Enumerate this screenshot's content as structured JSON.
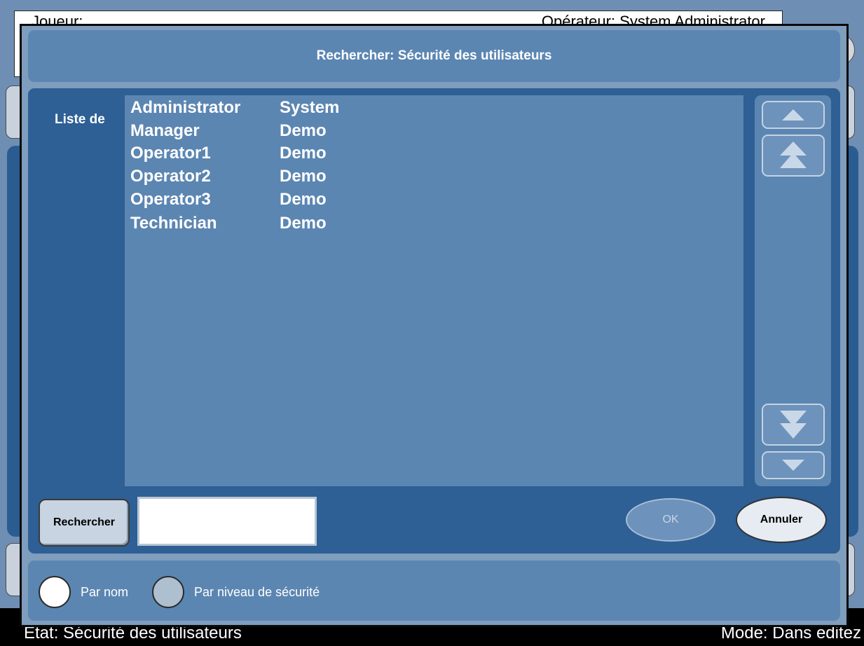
{
  "background": {
    "top_left_text": "Joueur:",
    "top_right_text": "Opérateur: System Administrator",
    "status_left": "État: Sécurité des utilisateurs",
    "status_right": "Mode: Dans editez"
  },
  "dialog": {
    "title": "Rechercher: Sécurité des utilisateurs",
    "list_label": "Liste de",
    "rows": [
      {
        "name": "Administrator",
        "group": "System"
      },
      {
        "name": "Manager",
        "group": "Demo"
      },
      {
        "name": "Operator1",
        "group": "Demo"
      },
      {
        "name": "Operator2",
        "group": "Demo"
      },
      {
        "name": "Operator3",
        "group": "Demo"
      },
      {
        "name": "Technician",
        "group": "Demo"
      }
    ],
    "scroll_icons": [
      "arrow-up-icon",
      "double-arrow-up-icon",
      "double-arrow-down-icon",
      "arrow-down-icon"
    ],
    "search_button": "Rechercher",
    "search_value": "",
    "ok_button": "OK",
    "cancel_button": "Annuler",
    "sort_options": [
      {
        "label": "Par nom",
        "selected": true
      },
      {
        "label": "Par niveau de sécurité",
        "selected": false
      }
    ]
  },
  "colors": {
    "dialog_bg": "#7f9dbd",
    "panel_dark": "#2e5f95",
    "panel_light": "#5c86b2",
    "status_bar": "#000000"
  }
}
